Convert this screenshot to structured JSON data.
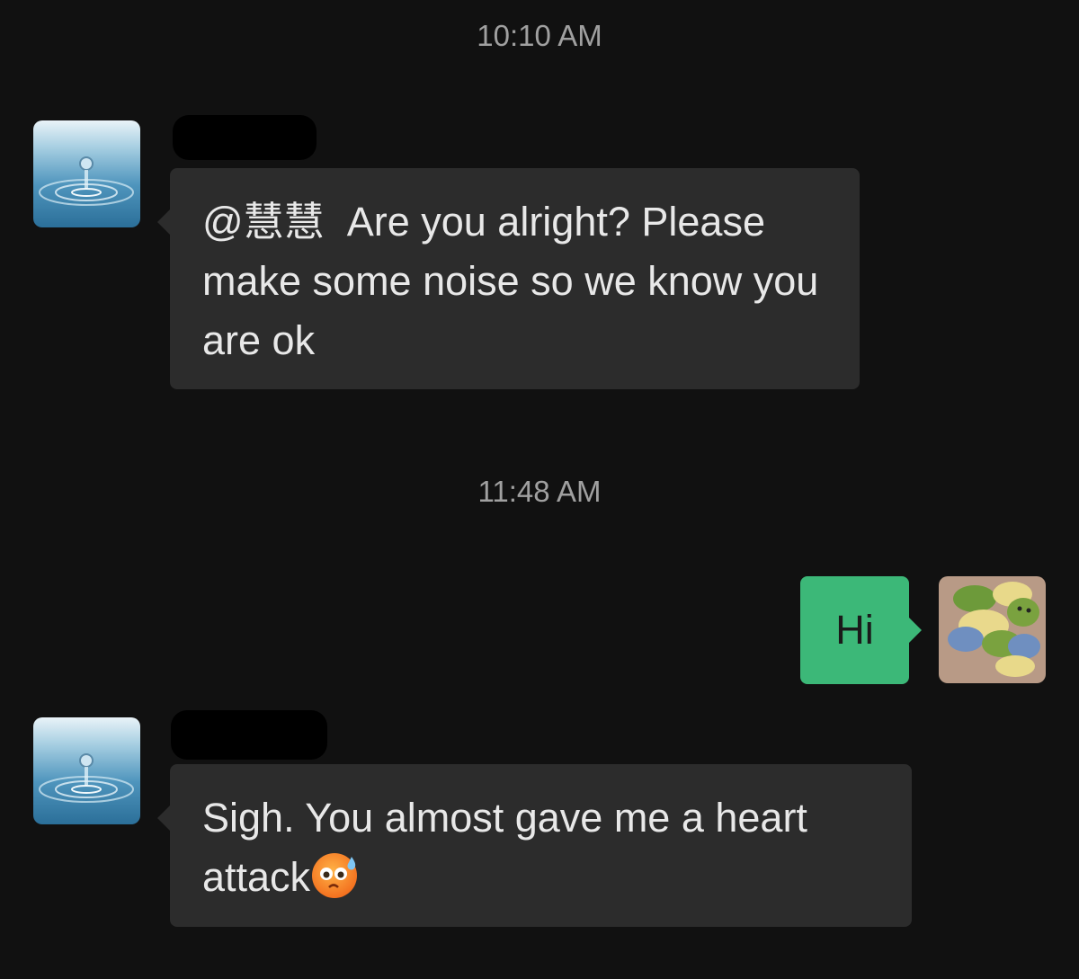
{
  "chat": {
    "messages": [
      {
        "timestamp": "10:10 AM",
        "direction": "incoming",
        "mention": "@慧慧",
        "text": "Are you alright? Please make some noise so we know you are ok",
        "avatar_icon": "water-drop-avatar"
      },
      {
        "timestamp": "11:48 AM",
        "direction": "outgoing",
        "text": "Hi",
        "avatar_icon": "plush-toys-avatar"
      },
      {
        "direction": "incoming",
        "text": "Sigh. You almost gave me a heart attack",
        "emoji_icon": "anxious-sweat-face-icon",
        "avatar_icon": "water-drop-avatar"
      }
    ]
  },
  "colors": {
    "background": "#111111",
    "incoming_bubble": "#2c2c2c",
    "outgoing_bubble": "#3cb878",
    "timestamp_text": "#a0a0a0"
  }
}
